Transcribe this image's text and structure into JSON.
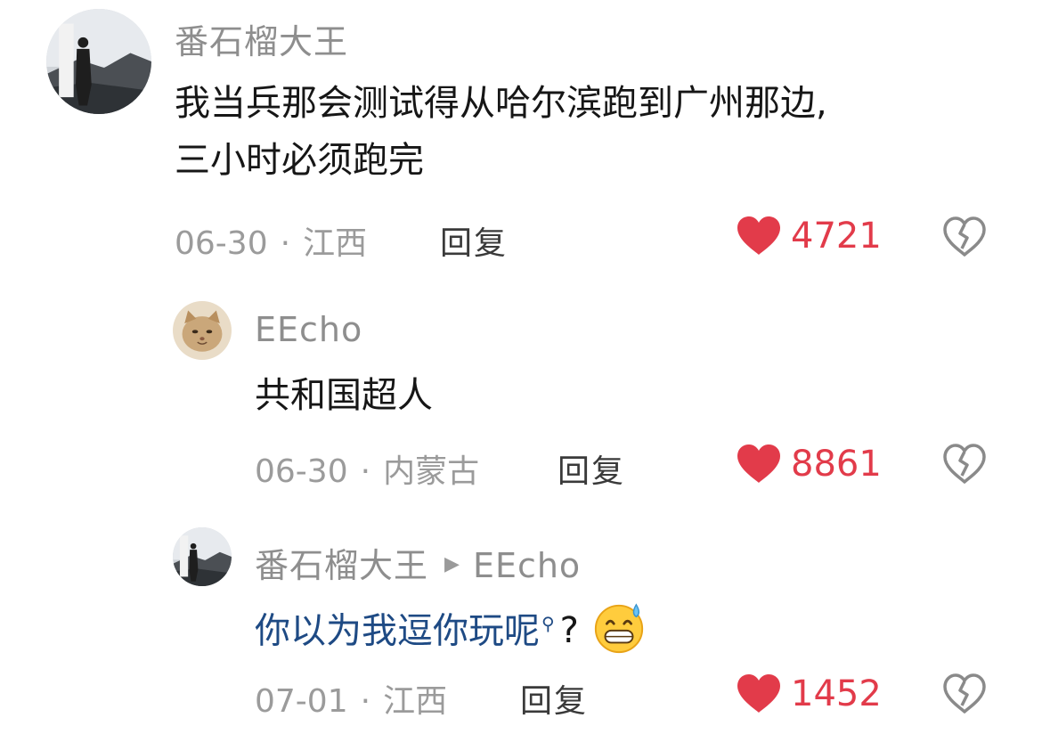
{
  "colors": {
    "like_red": "#e23b4a",
    "link_blue": "#1e4a84",
    "meta_gray": "#9b9b9b"
  },
  "comments": [
    {
      "username": "番石榴大王",
      "text_line1": "我当兵那会测试得从哈尔滨跑到广州那边,",
      "text_line2": "三小时必须跑完",
      "date": "06-30",
      "location": "江西",
      "reply_label": "回复",
      "likes": "4721",
      "avatar_icon": "person-silhouette-avatar"
    },
    {
      "username": "EEcho",
      "text_line1": "共和国超人",
      "date": "06-30",
      "location": "内蒙古",
      "reply_label": "回复",
      "likes": "8861",
      "avatar_icon": "cat-face-avatar"
    },
    {
      "username": "番石榴大王",
      "reply_to": "EEcho",
      "text_line1": "你以为我逗你玩呢",
      "text_suffix": "?",
      "date": "07-01",
      "location": "江西",
      "reply_label": "回复",
      "likes": "1452",
      "emoji_icon": "grinning-sweat-emoji"
    }
  ],
  "icons": {
    "like": "heart-icon",
    "dislike": "broken-heart-icon",
    "search_hint": "search-icon"
  }
}
